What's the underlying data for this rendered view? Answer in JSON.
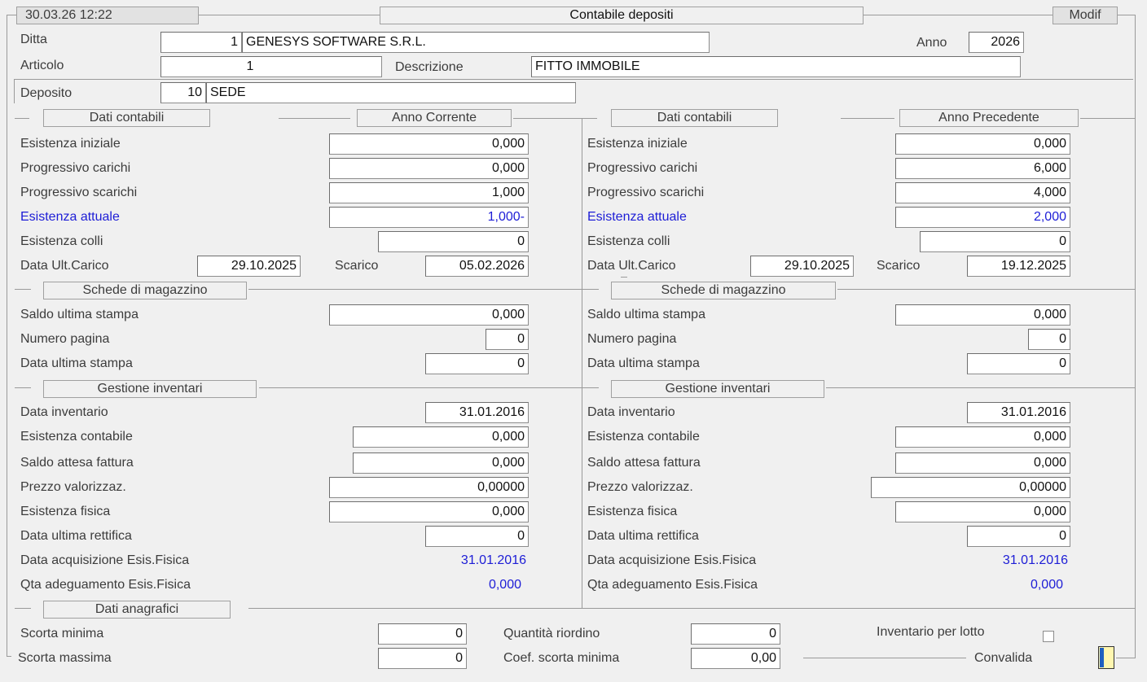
{
  "header": {
    "datetime": "30.03.26 12:22",
    "title": "Contabile depositi",
    "mode": "Modif"
  },
  "ditta": {
    "label": "Ditta",
    "code": "1",
    "name": "GENESYS SOFTWARE S.R.L."
  },
  "anno": {
    "label": "Anno",
    "value": "2026"
  },
  "articolo": {
    "label": "Articolo",
    "code": "1",
    "desc_label": "Descrizione",
    "desc": "FITTO IMMOBILE"
  },
  "deposito": {
    "label": "Deposito",
    "code": "10",
    "name": "SEDE"
  },
  "left": {
    "section": "Dati contabili",
    "year_label": "Anno Corrente",
    "esistenza_iniziale": {
      "label": "Esistenza iniziale",
      "value": "0,000"
    },
    "progressivo_carichi": {
      "label": "Progressivo carichi",
      "value": "0,000"
    },
    "progressivo_scarichi": {
      "label": "Progressivo scarichi",
      "value": "1,000"
    },
    "esistenza_attuale": {
      "label": "Esistenza attuale",
      "value": "1,000-"
    },
    "esistenza_colli": {
      "label": "Esistenza colli",
      "value": "0"
    },
    "data_ult_carico": {
      "label": "Data Ult.Carico",
      "value": "29.10.2025",
      "scarico_label": "Scarico",
      "scarico": "05.02.2026"
    },
    "schede_section": "Schede di magazzino",
    "saldo_ultima_stampa": {
      "label": "Saldo ultima stampa",
      "value": "0,000"
    },
    "numero_pagina": {
      "label": "Numero pagina",
      "value": "0"
    },
    "data_ultima_stampa": {
      "label": "Data ultima stampa",
      "value": "0"
    },
    "inventari_section": "Gestione inventari",
    "data_inventario": {
      "label": "Data inventario",
      "value": "31.01.2016"
    },
    "esistenza_contabile": {
      "label": "Esistenza contabile",
      "value": "0,000"
    },
    "saldo_attesa_fattura": {
      "label": "Saldo attesa fattura",
      "value": "0,000"
    },
    "prezzo_valorizzaz": {
      "label": "Prezzo valorizzaz.",
      "value": "0,00000"
    },
    "esistenza_fisica": {
      "label": "Esistenza fisica",
      "value": "0,000"
    },
    "data_ultima_rettifica": {
      "label": "Data ultima rettifica",
      "value": "0"
    },
    "data_acquisizione": {
      "label": "Data acquisizione Esis.Fisica",
      "value": "31.01.2016"
    },
    "qta_adeguamento": {
      "label": "Qta adeguamento Esis.Fisica",
      "value": "0,000"
    }
  },
  "right": {
    "section": "Dati contabili",
    "year_label": "Anno Precedente",
    "esistenza_iniziale": {
      "label": "Esistenza iniziale",
      "value": "0,000"
    },
    "progressivo_carichi": {
      "label": "Progressivo carichi",
      "value": "6,000"
    },
    "progressivo_scarichi": {
      "label": "Progressivo scarichi",
      "value": "4,000"
    },
    "esistenza_attuale": {
      "label": "Esistenza attuale",
      "value": "2,000"
    },
    "esistenza_colli": {
      "label": "Esistenza colli",
      "value": "0"
    },
    "data_ult_carico": {
      "label": "Data Ult.Carico",
      "value": "29.10.2025",
      "scarico_label": "Scarico",
      "scarico": "19.12.2025"
    },
    "schede_section": "Schede di magazzino",
    "saldo_ultima_stampa": {
      "label": "Saldo ultima stampa",
      "value": "0,000"
    },
    "numero_pagina": {
      "label": "Numero pagina",
      "value": "0"
    },
    "data_ultima_stampa": {
      "label": "Data ultima stampa",
      "value": "0"
    },
    "inventari_section": "Gestione inventari",
    "data_inventario": {
      "label": "Data inventario",
      "value": "31.01.2016"
    },
    "esistenza_contabile": {
      "label": "Esistenza contabile",
      "value": "0,000"
    },
    "saldo_attesa_fattura": {
      "label": "Saldo attesa fattura",
      "value": "0,000"
    },
    "prezzo_valorizzaz": {
      "label": "Prezzo valorizzaz.",
      "value": "0,00000"
    },
    "esistenza_fisica": {
      "label": "Esistenza fisica",
      "value": "0,000"
    },
    "data_ultima_rettifica": {
      "label": "Data ultima rettifica",
      "value": "0"
    },
    "data_acquisizione": {
      "label": "Data acquisizione Esis.Fisica",
      "value": "31.01.2016"
    },
    "qta_adeguamento": {
      "label": "Qta adeguamento Esis.Fisica",
      "value": "0,000"
    }
  },
  "anagrafici": {
    "section": "Dati anagrafici",
    "scorta_minima": {
      "label": "Scorta minima",
      "value": "0"
    },
    "scorta_massima": {
      "label": "Scorta massima",
      "value": "0"
    },
    "quantita_riordino": {
      "label": "Quantità riordino",
      "value": "0"
    },
    "coef_scorta_minima": {
      "label": "Coef. scorta minima",
      "value": "0,00"
    },
    "inventario_per_lotto": {
      "label": "Inventario per lotto",
      "checked": false
    },
    "convalida_label": "Convalida"
  },
  "colors": {
    "accent_blue": "#1d1dd6",
    "teal": "#1a7f7f"
  }
}
